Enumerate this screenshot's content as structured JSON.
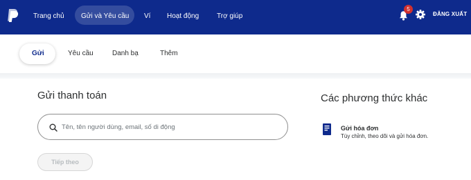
{
  "colors": {
    "nav_bg": "#0e2a8c",
    "badge": "#d1302f",
    "accent": "#0e2a8c"
  },
  "topnav": {
    "logo_icon": "paypal-logo-icon",
    "items": [
      {
        "label": "Trang chủ"
      },
      {
        "label": "Gửi và Yêu cầu",
        "active": true
      },
      {
        "label": "Ví"
      },
      {
        "label": "Hoạt động"
      },
      {
        "label": "Trợ giúp"
      }
    ],
    "notifications": {
      "icon": "bell-icon",
      "count": "5"
    },
    "settings_icon": "gear-icon",
    "logout_label": "ĐĂNG XUẤT"
  },
  "subnav": {
    "items": [
      {
        "label": "Gửi",
        "active": true
      },
      {
        "label": "Yêu cầu"
      },
      {
        "label": "Danh bạ"
      },
      {
        "label": "Thêm"
      }
    ]
  },
  "send": {
    "title": "Gửi thanh toán",
    "search_placeholder": "Tên, tên người dùng, email, số di động",
    "search_value": "",
    "next_label": "Tiếp theo"
  },
  "other": {
    "title": "Các phương thức khác",
    "invoice": {
      "icon": "invoice-icon",
      "title": "Gửi hóa đơn",
      "description": "Tùy chỉnh, theo dõi và gửi hóa đơn."
    }
  }
}
